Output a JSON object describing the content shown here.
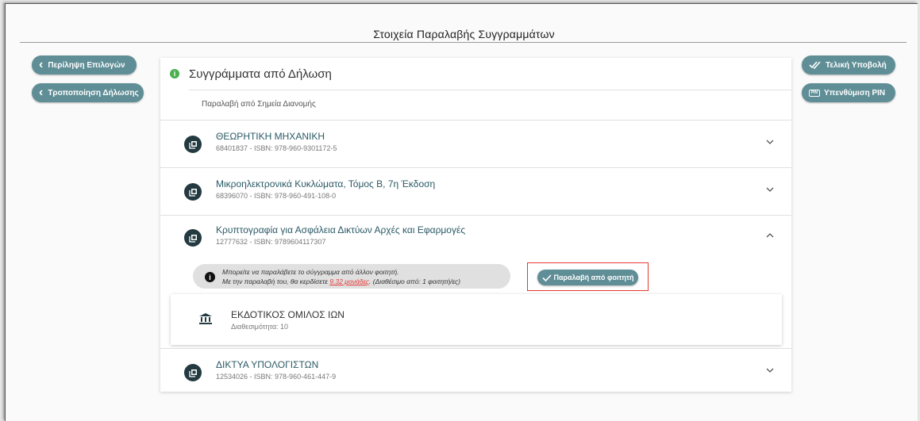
{
  "page": {
    "title": "Στοιχεία Παραλαβής Συγγραμμάτων"
  },
  "left_buttons": {
    "summary_label": "Περίληψη Επιλογών",
    "modify_label": "Τροποποίηση Δήλωσης"
  },
  "right_buttons": {
    "final_submit_label": "Τελική Υποβολή",
    "pin_reminder_label": "Υπενθύμιση PIN",
    "pin_badge": "PIN"
  },
  "panel": {
    "title": "Συγγράμματα από Δήλωση",
    "subtitle": "Παραλαβή από Σημεία Διανομής"
  },
  "books": [
    {
      "title": "ΘΕΩΡΗΤΙΚΗ ΜΗΧΑΝΙΚΗ",
      "meta": "68401837 - ISBN: 978-960-9301172-5",
      "expanded": false
    },
    {
      "title": "Μικροηλεκτρονικά Κυκλώματα, Τόμος Β, 7η Έκδοση",
      "meta": "68396070 - ISBN: 978-960-491-108-0",
      "expanded": false
    },
    {
      "title": "Κρυπτογραφία για Ασφάλεια Δικτύων Αρχές και Εφαρμογές",
      "meta": "12777632 - ISBN: 9789604117307",
      "expanded": true
    },
    {
      "title": "ΔΙΚΤΥΑ ΥΠΟΛΟΓΙΣΤΩΝ",
      "meta": "12534026 - ISBN: 978-960-461-447-9",
      "expanded": false
    }
  ],
  "notice": {
    "line1": "Μπορείτε να παραλάβετε το σύγγραμμα από άλλον φοιτητή.",
    "line2_prefix": "Με την παραλαβή του, θα κερδίσετε ",
    "credits": "9.32 μονάδες",
    "line2_suffix": ". (Διαθέσιμο από: 1 φοιτητή/ες)"
  },
  "pickup_button": {
    "label": "Παραλαβή από φοιτητή"
  },
  "publisher": {
    "name": "ΕΚΔΟΤΙΚΟΣ ΟΜΙΛΟΣ ΙΩΝ",
    "availability": "Διαθεσιμότητα: 10"
  },
  "colors": {
    "accent": "#5f8e96",
    "book_icon_bg": "#223a40",
    "book_title": "#2b5a66",
    "highlight": "#e53935",
    "info_green": "#4caf50"
  },
  "icons": {
    "back": "chevron-left-icon",
    "submit": "double-check-icon",
    "pin": "pin-icon",
    "book": "book-icon",
    "publisher": "institution-icon",
    "expand": "chevron-down-icon",
    "collapse": "chevron-up-icon"
  }
}
